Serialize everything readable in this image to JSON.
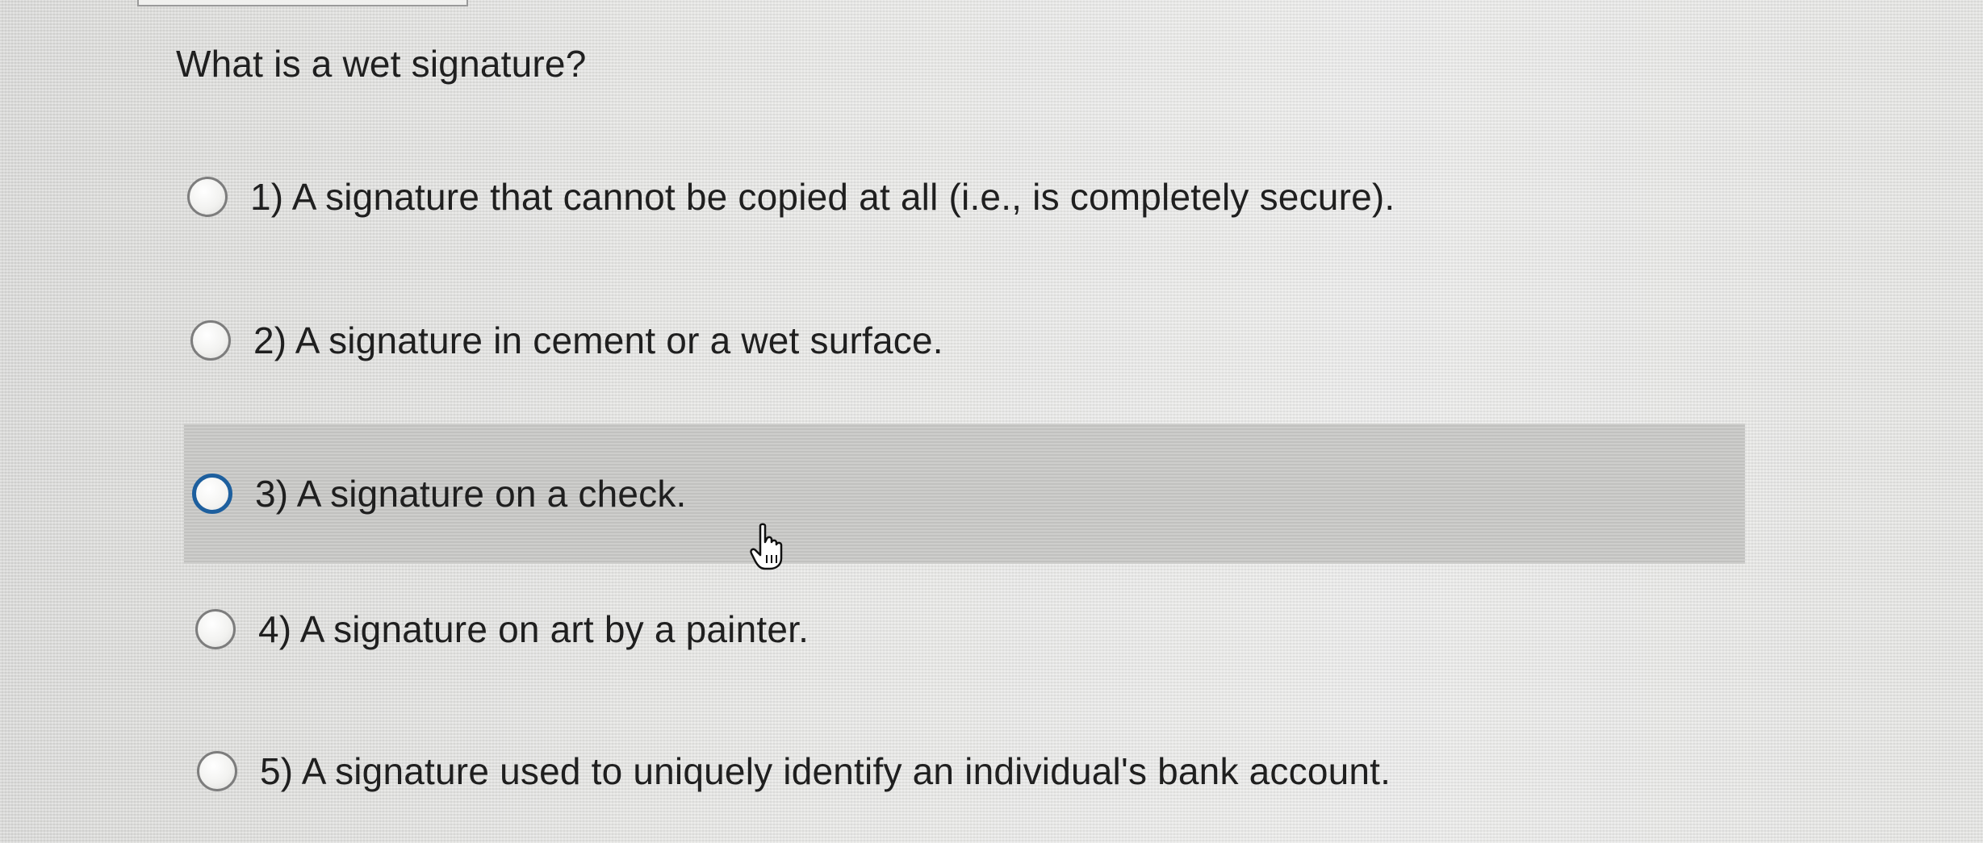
{
  "question": {
    "text": "What is a wet signature?"
  },
  "options": [
    {
      "label": "1)  A signature that cannot be copied at all (i.e., is completely secure).",
      "selected": false,
      "hovered": false
    },
    {
      "label": "2)  A signature in cement or a wet surface.",
      "selected": false,
      "hovered": false
    },
    {
      "label": "3)  A signature on a check.",
      "selected": false,
      "hovered": true
    },
    {
      "label": "4)  A signature on art by a painter.",
      "selected": false,
      "hovered": false
    },
    {
      "label": "5)  A signature used to uniquely identify an individual's bank account.",
      "selected": false,
      "hovered": false
    }
  ],
  "colors": {
    "background": "#e7e7e5",
    "highlight": "#c7c7c5",
    "focus_ring": "#1d5f9e",
    "text": "#1f1f1f"
  },
  "icons": {
    "cursor": "hand-pointer-icon",
    "radio": "radio-button-icon"
  }
}
